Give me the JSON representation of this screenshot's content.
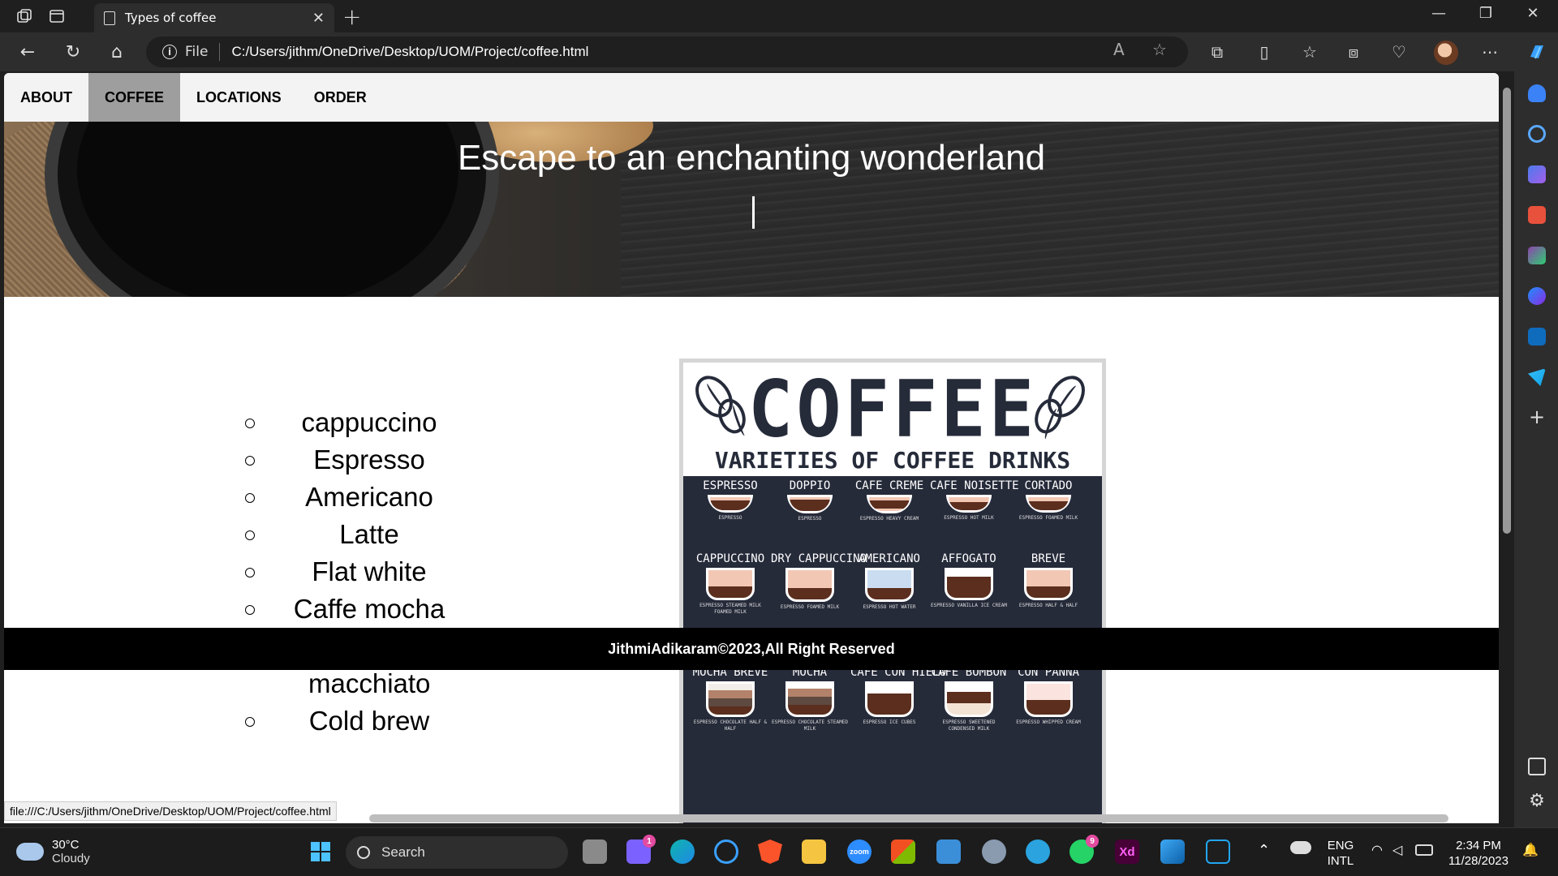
{
  "browser": {
    "tab_title": "Types of coffee",
    "address_scheme": "File",
    "address_url": "C:/Users/jithm/OneDrive/Desktop/UOM/Project/coffee.html",
    "status_url": "file:///C:/Users/jithm/OneDrive/Desktop/UOM/Project/coffee.html"
  },
  "site": {
    "nav": [
      "ABOUT",
      "COFFEE",
      "LOCATIONS",
      "ORDER"
    ],
    "active_nav": "COFFEE",
    "headline": "Escape to an enchanting wonderland",
    "coffee_types": [
      "cappuccino",
      "Espresso",
      "Americano",
      "Latte",
      "Flat white",
      "Caffe mocha",
      "Caffe macchiato",
      "Cold brew"
    ],
    "poster": {
      "title": "COFFEE",
      "subtitle": "VARIETIES OF COFFEE DRINKS",
      "drinks": [
        {
          "name": "ESPRESSO",
          "ingredients": "ESPRESSO"
        },
        {
          "name": "DOPPIO",
          "ingredients": "ESPRESSO"
        },
        {
          "name": "CAFE CREME",
          "ingredients": "ESPRESSO HEAVY CREAM"
        },
        {
          "name": "CAFE NOISETTE",
          "ingredients": "ESPRESSO HOT MILK"
        },
        {
          "name": "CORTADO",
          "ingredients": "ESPRESSO FOAMED MILK"
        },
        {
          "name": "CAPPUCCINO",
          "ingredients": "ESPRESSO STEAMED MILK FOAMED MILK"
        },
        {
          "name": "DRY CAPPUCCINO",
          "ingredients": "ESPRESSO FOAMED MILK"
        },
        {
          "name": "AMERICANO",
          "ingredients": "ESPRESSO HOT WATER"
        },
        {
          "name": "AFFOGATO",
          "ingredients": "ESPRESSO VANILLA ICE CREAM"
        },
        {
          "name": "BREVE",
          "ingredients": "ESPRESSO HALF & HALF"
        },
        {
          "name": "MOCHA BREVE",
          "ingredients": "ESPRESSO CHOCOLATE HALF & HALF"
        },
        {
          "name": "MOCHA",
          "ingredients": "ESPRESSO CHOCOLATE STEAMED MILK"
        },
        {
          "name": "CAFE CON HIELO",
          "ingredients": "ESPRESSO ICE CUBES"
        },
        {
          "name": "CAFE BOMBON",
          "ingredients": "ESPRESSO SWEETENED CONDENSED MILK"
        },
        {
          "name": "CON PANNA",
          "ingredients": "ESPRESSO WHIPPED CREAM"
        }
      ]
    },
    "footer": "JithmiAdikaram©2023,All Right Reserved"
  },
  "taskbar": {
    "weather_temp": "30°C",
    "weather_desc": "Cloudy",
    "search_label": "Search",
    "teams_badge": "1",
    "whatsapp_badge": "9",
    "zoom_label": "zoom",
    "xd_label": "Xd",
    "lang_1": "ENG",
    "lang_2": "INTL",
    "time": "2:34 PM",
    "date": "11/28/2023"
  },
  "colors": {
    "poster_bg": "#262b3a",
    "active_nav": "#9e9e9e",
    "footer_bg": "#000000",
    "espresso": "#5b2e1e",
    "milk": "#f2c7b4",
    "water": "#c9dcf0"
  }
}
